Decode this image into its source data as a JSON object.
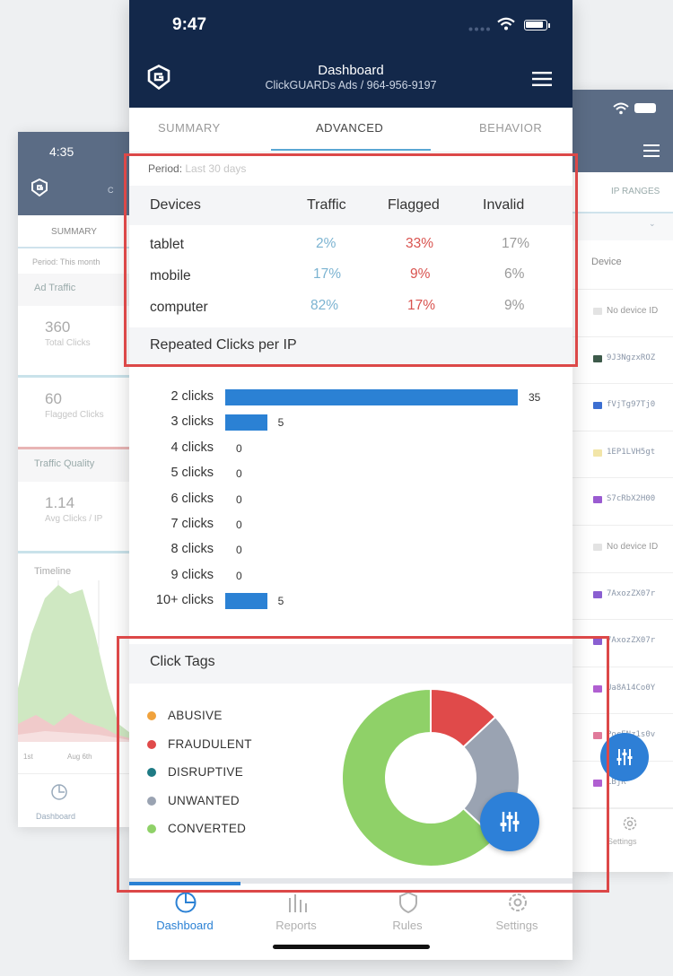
{
  "left_phone": {
    "time": "4:35",
    "header_extra": "C",
    "tab": "SUMMARY",
    "period": "Period: This month",
    "ad_traffic_label": "Ad Traffic",
    "total_clicks_value": "360",
    "total_clicks_label": "Total Clicks",
    "flagged_clicks_value": "60",
    "flagged_clicks_label": "Flagged Clicks",
    "traffic_quality_label": "Traffic Quality",
    "avg_clicks_value": "1.14",
    "avg_clicks_label": "Avg Clicks / IP",
    "timeline_label": "Timeline",
    "axis_label_1": "1st",
    "axis_label_2": "Aug 6th",
    "nav_label": "Dashboard"
  },
  "right_phone": {
    "tab": "IP RANGES",
    "column_header": "Device",
    "rows": [
      {
        "text": "No device ID",
        "color": "#e3e3e3",
        "plain": true
      },
      {
        "text": "9J3NgzxROZ",
        "color": "#3d5a4a",
        "plain": false
      },
      {
        "text": "fVjTg97Tj0",
        "color": "#3c6fd1",
        "plain": false
      },
      {
        "text": "1EP1LVH5gt",
        "color": "#f2e5a8",
        "plain": false
      },
      {
        "text": "S7cRbX2H00",
        "color": "#9a5bd1",
        "plain": false
      },
      {
        "text": "No device ID",
        "color": "#e3e3e3",
        "plain": true
      },
      {
        "text": "7AxozZX07r",
        "color": "#8a5fd1",
        "plain": false
      },
      {
        "text": "7AxozZX07r",
        "color": "#8a5fd1",
        "plain": false
      },
      {
        "text": "Ua8A14Co0Y",
        "color": "#b05fd1",
        "plain": false
      },
      {
        "text": "PocENz1s0v",
        "color": "#e07a9a",
        "plain": false
      },
      {
        "text": "LBjK",
        "color": "#b05fd1",
        "plain": false
      }
    ],
    "nav_label": "Settings"
  },
  "main": {
    "status_time": "9:47",
    "header_title": "Dashboard",
    "header_subtitle": "ClickGUARDs Ads / 964-956-9197",
    "tabs": [
      {
        "label": "SUMMARY",
        "active": false
      },
      {
        "label": "ADVANCED",
        "active": true
      },
      {
        "label": "BEHAVIOR",
        "active": false
      }
    ],
    "period_label": "Period:",
    "period_value": "Last 30 days",
    "devices_table": {
      "headers": [
        "Devices",
        "Traffic",
        "Flagged",
        "Invalid"
      ],
      "rows": [
        {
          "device": "tablet",
          "traffic": "2%",
          "flagged": "33%",
          "invalid": "17%"
        },
        {
          "device": "mobile",
          "traffic": "17%",
          "flagged": "9%",
          "invalid": "6%"
        },
        {
          "device": "computer",
          "traffic": "82%",
          "flagged": "17%",
          "invalid": "9%"
        }
      ]
    },
    "repeated_clicks_title": "Repeated Clicks per IP",
    "click_tags_title": "Click Tags",
    "nav": [
      {
        "label": "Dashboard",
        "icon": "dashboard-gauge-icon",
        "active": true
      },
      {
        "label": "Reports",
        "icon": "bar-chart-icon",
        "active": false
      },
      {
        "label": "Rules",
        "icon": "shield-icon",
        "active": false
      },
      {
        "label": "Settings",
        "icon": "gear-icon",
        "active": false
      }
    ]
  },
  "chart_data": [
    {
      "type": "bar",
      "orientation": "horizontal",
      "title": "Repeated Clicks per IP",
      "categories": [
        "2 clicks",
        "3 clicks",
        "4 clicks",
        "5 clicks",
        "6 clicks",
        "7 clicks",
        "8 clicks",
        "9 clicks",
        "10+ clicks"
      ],
      "values": [
        35,
        5,
        0,
        0,
        0,
        0,
        0,
        0,
        5
      ],
      "color": "#2b81d4"
    },
    {
      "type": "pie",
      "variant": "donut",
      "title": "Click Tags",
      "categories": [
        "ABUSIVE",
        "FRAUDULENT",
        "DISRUPTIVE",
        "UNWANTED",
        "CONVERTED"
      ],
      "colors": [
        "#f0a23c",
        "#e04a4a",
        "#1e7a84",
        "#9aa3b2",
        "#8fd168"
      ],
      "values": [
        0,
        13,
        0,
        24,
        63
      ],
      "legend_position": "left"
    }
  ],
  "colors": {
    "header_navy": "#13284a",
    "accent_blue": "#2b81d4",
    "callout_red": "#dc4848"
  }
}
